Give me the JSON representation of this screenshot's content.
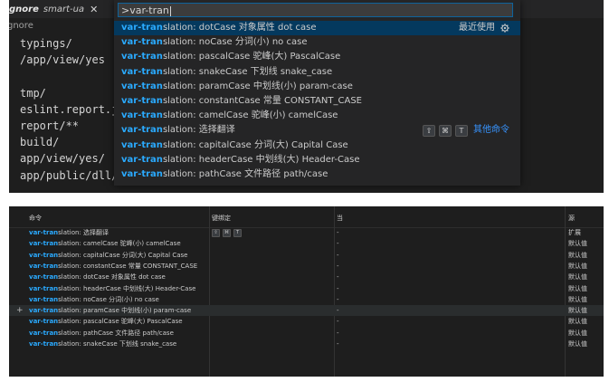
{
  "editor": {
    "tab_file": "gnore",
    "tab_project": "smart-ua",
    "tab_close": "✕",
    "sidebar_label": "gnore",
    "code_lines": [
      "typings/",
      "/app/view/yes",
      "",
      "tmp/",
      "eslint.report.json",
      "report/**",
      "build/",
      "app/view/yes/",
      "app/public/dll/"
    ]
  },
  "palette": {
    "query": ">var-tran",
    "items": [
      {
        "hl": "var-tran",
        "rest": "slation: dotCase 对象属性 dot case",
        "right_text": "最近使用",
        "right_icon": "gear-icon"
      },
      {
        "hl": "var-tran",
        "rest": "slation: noCase 分词(小) no case"
      },
      {
        "hl": "var-tran",
        "rest": "slation: pascalCase 驼峰(大) PascalCase"
      },
      {
        "hl": "var-tran",
        "rest": "slation: snakeCase 下划线 snake_case"
      },
      {
        "hl": "var-tran",
        "rest": "slation: paramCase 中划线(小) param-case"
      },
      {
        "hl": "var-tran",
        "rest": "slation: constantCase 常量 CONSTANT_CASE"
      },
      {
        "hl": "var-tran",
        "rest": "slation: camelCase 驼峰(小) camelCase"
      },
      {
        "hl": "var-tran",
        "rest": "slation: 选择翻译",
        "keys": [
          "⇧",
          "⌘",
          "T"
        ],
        "link": "其他命令"
      },
      {
        "hl": "var-tran",
        "rest": "slation: capitalCase 分词(大) Capital Case"
      },
      {
        "hl": "var-tran",
        "rest": "slation: headerCase 中划线(大) Header-Case"
      },
      {
        "hl": "var-tran",
        "rest": "slation: pathCase 文件路径 path/case"
      }
    ]
  },
  "keybindings": {
    "headers": [
      "命令",
      "键绑定",
      "当",
      "源"
    ],
    "rows": [
      {
        "hl": "var-tran",
        "rest": "slation: 选择翻译",
        "keys": [
          "⇧",
          "⌘",
          "T"
        ],
        "when": "-",
        "source": "扩展"
      },
      {
        "hl": "var-tran",
        "rest": "slation: camelCase 驼峰(小) camelCase",
        "keys": [],
        "when": "-",
        "source": "默认值"
      },
      {
        "hl": "var-tran",
        "rest": "slation: capitalCase 分词(大) Capital Case",
        "keys": [],
        "when": "-",
        "source": "默认值"
      },
      {
        "hl": "var-tran",
        "rest": "slation: constantCase 常量 CONSTANT_CASE",
        "keys": [],
        "when": "-",
        "source": "默认值"
      },
      {
        "hl": "var-tran",
        "rest": "slation: dotCase 对象属性 dot case",
        "keys": [],
        "when": "-",
        "source": "默认值"
      },
      {
        "hl": "var-tran",
        "rest": "slation: headerCase 中划线(大) Header-Case",
        "keys": [],
        "when": "-",
        "source": "默认值"
      },
      {
        "hl": "var-tran",
        "rest": "slation: noCase 分词(小) no case",
        "keys": [],
        "when": "-",
        "source": "默认值"
      },
      {
        "hl": "var-tran",
        "rest": "slation: paramCase 中划线(小) param-case",
        "keys": [],
        "when": "-",
        "source": "默认值",
        "plus": "+"
      },
      {
        "hl": "var-tran",
        "rest": "slation: pascalCase 驼峰(大) PascalCase",
        "keys": [],
        "when": "-",
        "source": "默认值"
      },
      {
        "hl": "var-tran",
        "rest": "slation: pathCase 文件路径 path/case",
        "keys": [],
        "when": "-",
        "source": "默认值"
      },
      {
        "hl": "var-tran",
        "rest": "slation: snakeCase 下划线 snake_case",
        "keys": [],
        "when": "-",
        "source": "默认值"
      }
    ]
  },
  "colors": {
    "highlight": "#2aaaff",
    "selected_row": "#04395e",
    "link": "#3794ff",
    "background": "#1e1e1e"
  }
}
